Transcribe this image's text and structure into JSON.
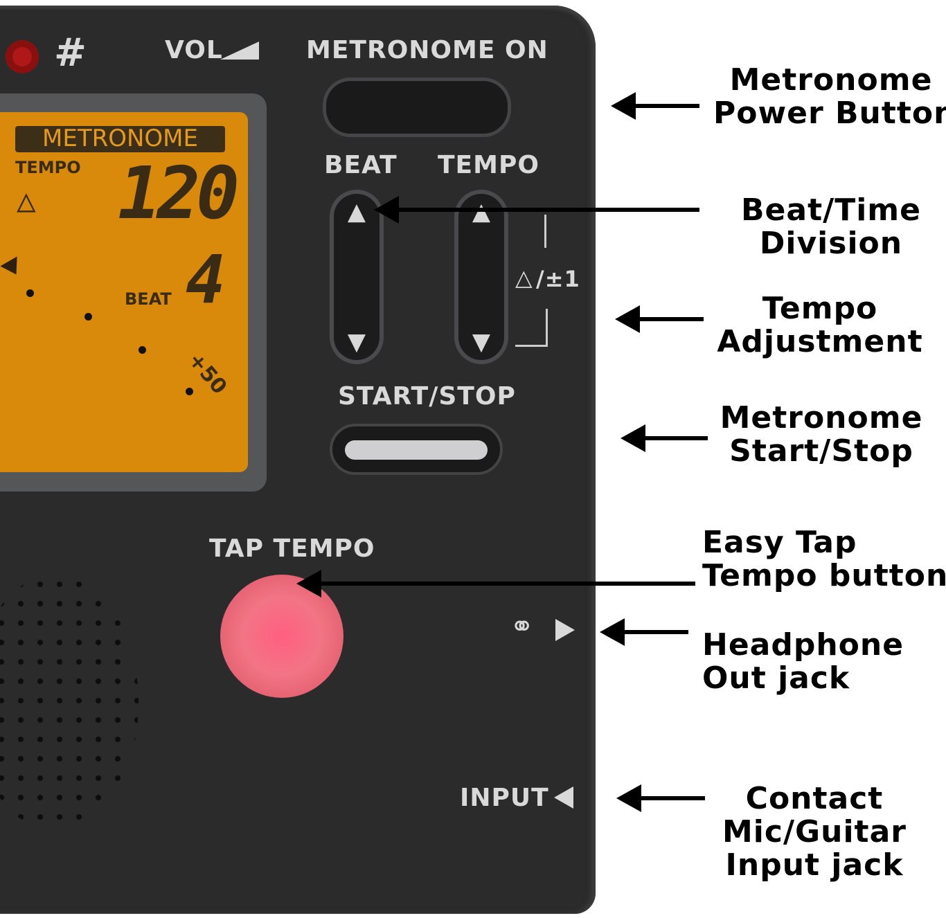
{
  "device": {
    "labels": {
      "sharp": "#",
      "vol": "VOL",
      "metronome_on": "METRONOME ON",
      "beat": "BEAT",
      "tempo": "TEMPO",
      "metronome_pm1": "/±1",
      "start_stop": "START/STOP",
      "tap_tempo": "TAP TEMPO",
      "input": "INPUT"
    },
    "lcd": {
      "mode": "METRONOME",
      "tempo_label": "TEMPO",
      "tempo_value": "120",
      "beat_value": "4",
      "beat_label": "BEAT",
      "scale_mark": "+50"
    },
    "colors": {
      "body": "#2b2b2c",
      "lcd": "#d98a0b",
      "tap_button": "#f06a7a"
    }
  },
  "annotations": [
    {
      "id": "power",
      "lines": [
        "Metronome",
        "Power Button"
      ]
    },
    {
      "id": "beat",
      "lines": [
        "Beat/Time",
        "Division"
      ]
    },
    {
      "id": "tempo",
      "lines": [
        "Tempo",
        "Adjustment"
      ]
    },
    {
      "id": "startstop",
      "lines": [
        "Metronome",
        "Start/Stop"
      ]
    },
    {
      "id": "tap",
      "lines": [
        "Easy Tap",
        "Tempo button"
      ]
    },
    {
      "id": "headphone",
      "lines": [
        "Headphone",
        "Out jack"
      ]
    },
    {
      "id": "input",
      "lines": [
        "Contact",
        "Mic/Guitar",
        "Input jack"
      ]
    }
  ]
}
